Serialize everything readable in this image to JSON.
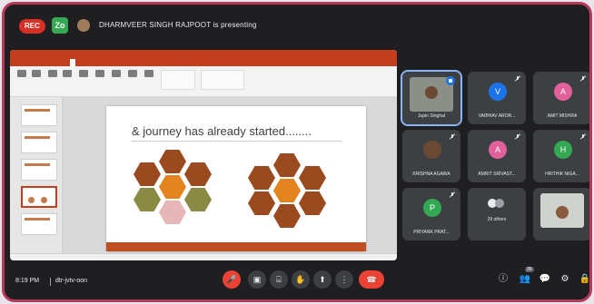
{
  "top_bar": {
    "rec_label": "REC",
    "badge_label": "Zo",
    "presenter_text": "DHARMVEER SINGH RAJPOOT is presenting"
  },
  "presentation": {
    "slide_title": "& journey has already started........",
    "app": "PowerPoint",
    "accent_color": "#c43e1c"
  },
  "participants": [
    {
      "name": "Jupin Singhal",
      "initial": "",
      "color": "#8ab4f8",
      "speaking": true,
      "photo": true
    },
    {
      "name": "VAIBHAV AROR...",
      "initial": "V",
      "color": "#1a73e8",
      "muted": true
    },
    {
      "name": "AMIT MISHRA",
      "initial": "A",
      "color": "#e2619a",
      "muted": true
    },
    {
      "name": "KRISHNA AGAWA",
      "initial": "",
      "color": "#6b4a33",
      "muted": true,
      "photo": true
    },
    {
      "name": "AMRIT SRIVAST...",
      "initial": "A",
      "color": "#e2619a",
      "muted": true
    },
    {
      "name": "HRITHIK NIGA...",
      "initial": "H",
      "color": "#34a853",
      "muted": true
    },
    {
      "name": "PRIYANK PRAT...",
      "initial": "P",
      "color": "#34a853",
      "muted": true
    },
    {
      "name": "29 others",
      "initial": "",
      "color": "#9aa0a6"
    },
    {
      "name": "",
      "initial": "",
      "color": "#8b8f88",
      "photo": true
    }
  ],
  "bottom_bar": {
    "time": "8:19 PM",
    "meeting_code": "dtr-jvtv-oon",
    "participant_count": "35"
  }
}
